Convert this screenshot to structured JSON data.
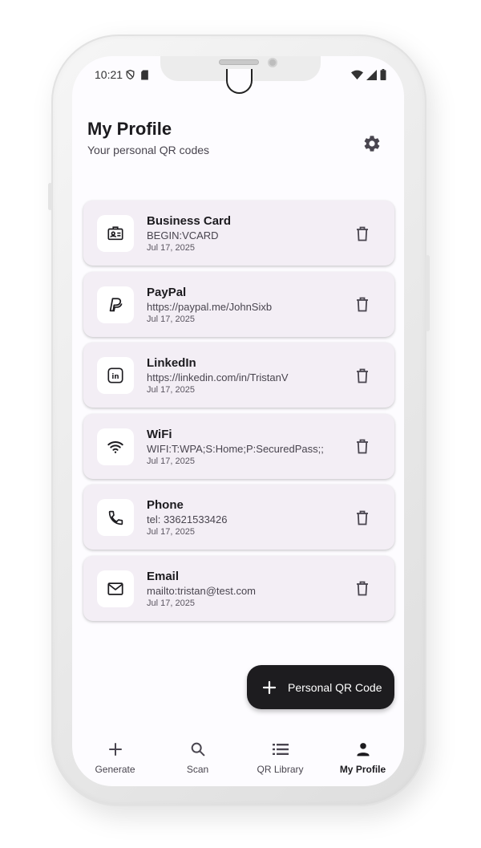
{
  "status_bar": {
    "time": "10:21"
  },
  "header": {
    "title": "My Profile",
    "subtitle": "Your personal QR codes"
  },
  "cards": [
    {
      "title": "Business Card",
      "value": "BEGIN:VCARD",
      "date": "Jul 17, 2025",
      "icon": "contact-card-icon"
    },
    {
      "title": "PayPal",
      "value": "https://paypal.me/JohnSixb",
      "date": "Jul 17, 2025",
      "icon": "paypal-icon"
    },
    {
      "title": "LinkedIn",
      "value": "https://linkedin.com/in/TristanV",
      "date": "Jul 17, 2025",
      "icon": "linkedin-icon"
    },
    {
      "title": "WiFi",
      "value": "WIFI:T:WPA;S:Home;P:SecuredPass;;",
      "date": "Jul 17, 2025",
      "icon": "wifi-icon"
    },
    {
      "title": "Phone",
      "value": "tel: 33621533426",
      "date": "Jul 17, 2025",
      "icon": "phone-icon"
    },
    {
      "title": "Email",
      "value": "mailto:tristan@test.com",
      "date": "Jul 17, 2025",
      "icon": "mail-icon"
    }
  ],
  "fab": {
    "label": "Personal QR Code"
  },
  "bottom_nav": {
    "items": [
      {
        "label": "Generate",
        "icon": "plus-icon"
      },
      {
        "label": "Scan",
        "icon": "search-icon"
      },
      {
        "label": "QR Library",
        "icon": "list-icon"
      },
      {
        "label": "My Profile",
        "icon": "person-icon"
      }
    ],
    "active": "My Profile"
  },
  "colors": {
    "card_bg": "#f3eef5",
    "fab_bg": "#1d1c1f",
    "text_primary": "#1c1b1f",
    "text_secondary": "#49454f"
  }
}
